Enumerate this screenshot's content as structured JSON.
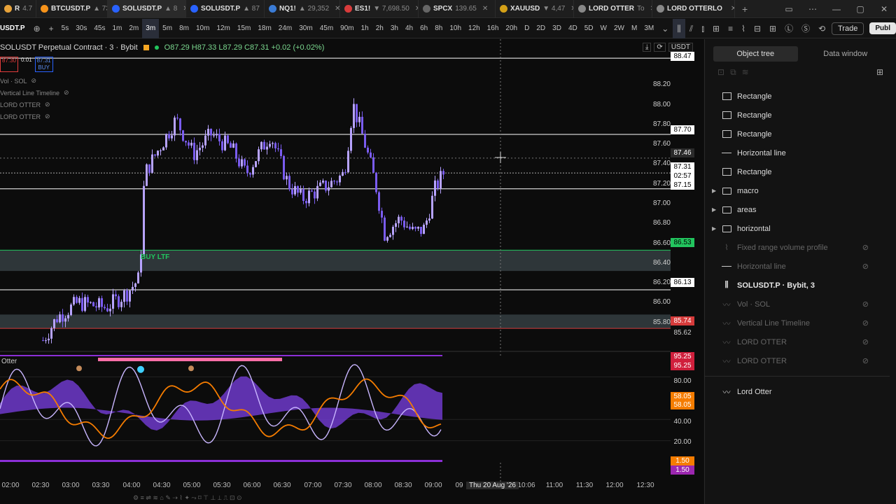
{
  "browser_tabs": [
    {
      "title": "R",
      "value": "4.7",
      "color": "#e8a33a",
      "active": false
    },
    {
      "title": "BTCUSDT.P",
      "value": "▲ 73",
      "color": "#f7931a",
      "active": false
    },
    {
      "title": "SOLUSDT.P",
      "value": "▲ 8",
      "color": "#2962ff",
      "active": true
    },
    {
      "title": "SOLUSDT.P",
      "value": "▲ 87",
      "color": "#2962ff",
      "active": false
    },
    {
      "title": "NQ1!",
      "value": "▲ 29,352",
      "color": "#3a7bd5",
      "active": false
    },
    {
      "title": "ES1!",
      "value": "▼ 7,698.50",
      "color": "#d83b3b",
      "active": false
    },
    {
      "title": "SPCX",
      "value": "139.65",
      "color": "#666666",
      "active": false
    },
    {
      "title": "XAUUSD",
      "value": "▼ 4,47",
      "color": "#d4a017",
      "active": false
    },
    {
      "title": "LORD OTTER",
      "value": "To",
      "color": "#888888",
      "active": false
    },
    {
      "title": "LORD OTTERLO",
      "value": "",
      "color": "#888888",
      "active": false
    }
  ],
  "toolbar": {
    "symbol": "USDT.P",
    "timeframes": [
      "5s",
      "30s",
      "45s",
      "1m",
      "2m",
      "3m",
      "5m",
      "8m",
      "10m",
      "12m",
      "15m",
      "18m",
      "24m",
      "30m",
      "45m",
      "90m",
      "1h",
      "2h",
      "3h",
      "4h",
      "6h",
      "8h",
      "10h",
      "12h",
      "16h",
      "20h",
      "D",
      "2D",
      "3D",
      "4D",
      "5D",
      "W",
      "2W",
      "M",
      "3M"
    ],
    "active_timeframe": "3m",
    "trade_label": "Trade",
    "publish_label": "Publ"
  },
  "chart": {
    "legend_symbol": "SOLUSDT Perpetual Contract · 3 · Bybit",
    "legend_ohlc": "O87.29 H87.33 L87.29 C87.31 +0.02 (+0.02%)",
    "tag_sell": "87.30",
    "tag_spread": "0.01",
    "tag_buy": "87.31",
    "tag_buy_label": "BUY",
    "indicators": [
      "Vol · SOL",
      "Vertical Line Timeline",
      "LORD OTTER",
      "LORD OTTER"
    ],
    "currency": "USDT",
    "buy_zone_label": "BUY LTF",
    "osc_label": "Otter",
    "price_ticks": [
      "88.20",
      "88.00",
      "87.80",
      "87.60",
      "87.40",
      "87.20",
      "87.00",
      "86.80",
      "86.60",
      "86.40",
      "86.20",
      "86.00",
      "85.80"
    ],
    "price_tags": [
      {
        "v": "88.47",
        "bg": "#ffffff",
        "fg": "#000000"
      },
      {
        "v": "87.70",
        "bg": "#ffffff",
        "fg": "#000000"
      },
      {
        "v": "87.46",
        "bg": "#2a2a2a",
        "fg": "#ffffff"
      },
      {
        "v": "87.31",
        "bg": "#ffffff",
        "fg": "#000000"
      },
      {
        "v": "02:57",
        "bg": "#ffffff",
        "fg": "#000000"
      },
      {
        "v": "87.15",
        "bg": "#ffffff",
        "fg": "#000000"
      },
      {
        "v": "86.53",
        "bg": "#22c55e",
        "fg": "#000000"
      },
      {
        "v": "86.13",
        "bg": "#ffffff",
        "fg": "#000000"
      },
      {
        "v": "85.74",
        "bg": "#d63b3b",
        "fg": "#ffffff"
      },
      {
        "v": "85.62",
        "bg": "#0c0c0c",
        "fg": "#cfcfcf"
      }
    ],
    "osc_tags": [
      {
        "v": "95.25",
        "bg": "#d01f3c",
        "fg": "#ffffff"
      },
      {
        "v": "95.25",
        "bg": "#d01f3c",
        "fg": "#ffffff"
      },
      {
        "v": "80.00",
        "bg": "#0c0c0c",
        "fg": "#cfcfcf"
      },
      {
        "v": "58.05",
        "bg": "#f57c00",
        "fg": "#ffffff"
      },
      {
        "v": "58.05",
        "bg": "#f57c00",
        "fg": "#ffffff"
      },
      {
        "v": "40.00",
        "bg": "#0c0c0c",
        "fg": "#cfcfcf"
      },
      {
        "v": "20.00",
        "bg": "#0c0c0c",
        "fg": "#cfcfcf"
      },
      {
        "v": "1.50",
        "bg": "#f57c00",
        "fg": "#ffffff"
      },
      {
        "v": "1.50",
        "bg": "#9c27b0",
        "fg": "#ffffff"
      }
    ],
    "time_ticks": [
      "02:00",
      "02:30",
      "03:00",
      "03:30",
      "04:00",
      "04:30",
      "05:00",
      "05:30",
      "06:00",
      "06:30",
      "07:00",
      "07:30",
      "08:00",
      "08:30",
      "09:00",
      "09",
      "Thu 20 Aug '26",
      "10:06",
      "11:00",
      "11:30",
      "12:00",
      "12:30"
    ],
    "crosshair_date": "Thu 20 Aug '26"
  },
  "panel": {
    "tab_object_tree": "Object tree",
    "tab_data_window": "Data window",
    "items": [
      {
        "label": "Rectangle",
        "type": "rect",
        "hidden": false
      },
      {
        "label": "Rectangle",
        "type": "rect",
        "hidden": false
      },
      {
        "label": "Rectangle",
        "type": "rect",
        "hidden": false
      },
      {
        "label": "Horizontal line",
        "type": "hline",
        "hidden": false
      },
      {
        "label": "Rectangle",
        "type": "rect",
        "hidden": false
      },
      {
        "label": "macro",
        "type": "folder",
        "hidden": false
      },
      {
        "label": "areas",
        "type": "folder",
        "hidden": false
      },
      {
        "label": "horizontal",
        "type": "folder",
        "hidden": false
      },
      {
        "label": "Fixed range volume profile",
        "type": "vp",
        "hidden": true
      },
      {
        "label": "Horizontal line",
        "type": "hline",
        "hidden": true
      },
      {
        "label": "SOLUSDT.P · Bybit, 3",
        "type": "candle",
        "hidden": false
      },
      {
        "label": "Vol · SOL",
        "type": "ind",
        "hidden": true
      },
      {
        "label": "Vertical Line Timeline",
        "type": "ind",
        "hidden": true
      },
      {
        "label": "LORD OTTER",
        "type": "ind",
        "hidden": true
      },
      {
        "label": "LORD OTTER",
        "type": "ind",
        "hidden": true
      }
    ],
    "footer_item": "Lord Otter"
  }
}
